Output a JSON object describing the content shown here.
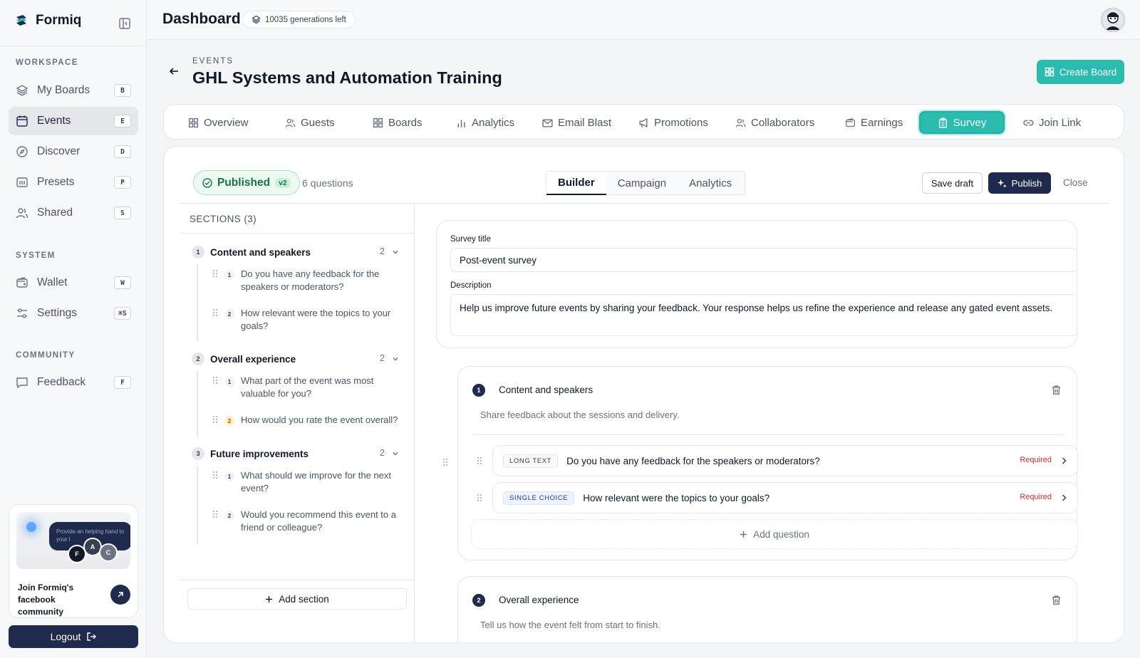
{
  "app": {
    "name": "Formiq"
  },
  "sidebar": {
    "sections": [
      {
        "label": "WORKSPACE",
        "items": [
          {
            "label": "My Boards",
            "key": "B",
            "icon": "layers-icon"
          },
          {
            "label": "Events",
            "key": "E",
            "icon": "calendar-icon",
            "active": true
          },
          {
            "label": "Discover",
            "key": "D",
            "icon": "compass-icon"
          },
          {
            "label": "Presets",
            "key": "P",
            "icon": "presets-icon"
          },
          {
            "label": "Shared",
            "key": "S",
            "icon": "users-icon"
          }
        ]
      },
      {
        "label": "SYSTEM",
        "items": [
          {
            "label": "Wallet",
            "key": "W",
            "icon": "wallet-icon"
          },
          {
            "label": "Settings",
            "key": "⌘S",
            "icon": "sliders-icon"
          }
        ]
      },
      {
        "label": "COMMUNITY",
        "items": [
          {
            "label": "Feedback",
            "key": "F",
            "icon": "message-icon"
          }
        ]
      }
    ],
    "community_card": {
      "bubble_text": "Provide an helping hand to your l",
      "avatars": [
        "F",
        "A",
        "C"
      ],
      "text": "Join Formiq's facebook community"
    },
    "logout_label": "Logout"
  },
  "topbar": {
    "title": "Dashboard",
    "generations": "10035 generations left"
  },
  "header": {
    "eyebrow": "EVENTS",
    "title": "GHL Systems and Automation Training",
    "create_board": "Create Board"
  },
  "tabs": [
    {
      "label": "Overview",
      "icon": "grid-icon"
    },
    {
      "label": "Guests",
      "icon": "users-icon"
    },
    {
      "label": "Boards",
      "icon": "grid-icon"
    },
    {
      "label": "Analytics",
      "icon": "bar-chart-icon"
    },
    {
      "label": "Email Blast",
      "icon": "mail-icon"
    },
    {
      "label": "Promotions",
      "icon": "megaphone-icon"
    },
    {
      "label": "Collaborators",
      "icon": "users-icon"
    },
    {
      "label": "Earnings",
      "icon": "wallet-icon"
    },
    {
      "label": "Survey",
      "icon": "clipboard-icon",
      "active": true
    },
    {
      "label": "Join Link",
      "icon": "link-icon"
    }
  ],
  "survey": {
    "status": "Published",
    "version": "v2",
    "question_count": "6 questions",
    "modes": [
      "Builder",
      "Campaign",
      "Analytics"
    ],
    "active_mode": "Builder",
    "save_draft": "Save draft",
    "publish": "Publish",
    "close": "Close",
    "sections_heading": "SECTIONS (3)",
    "add_section": "Add section",
    "sections": [
      {
        "num": "1",
        "title": "Content and speakers",
        "count": "2",
        "questions": [
          {
            "num": "1",
            "text": "Do you have any feedback for the speakers or moderators?"
          },
          {
            "num": "2",
            "text": "How relevant were the topics to your goals?"
          }
        ]
      },
      {
        "num": "2",
        "title": "Overall experience",
        "count": "2",
        "questions": [
          {
            "num": "1",
            "text": "What part of the event was most valuable for you?"
          },
          {
            "num": "2",
            "text": "How would you rate the event overall?"
          }
        ]
      },
      {
        "num": "3",
        "title": "Future improvements",
        "count": "2",
        "questions": [
          {
            "num": "1",
            "text": "What should we improve for the next event?"
          },
          {
            "num": "2",
            "text": "Would you recommend this event to a friend or colleague?"
          }
        ]
      }
    ],
    "form": {
      "title_label": "Survey title",
      "title_value": "Post-event survey",
      "desc_label": "Description",
      "desc_value": "Help us improve future events by sharing your feedback. Your response helps us refine the experience and release any gated event assets."
    },
    "builder_sections": [
      {
        "num": "1",
        "title": "Content and speakers",
        "desc": "Share feedback about the sessions and delivery.",
        "questions": [
          {
            "type": "LONG TEXT",
            "text": "Do you have any feedback for the speakers or moderators?",
            "required": "Required"
          },
          {
            "type": "SINGLE CHOICE",
            "text": "How relevant were the topics to your goals?",
            "required": "Required"
          }
        ],
        "add_question": "Add question"
      },
      {
        "num": "2",
        "title": "Overall experience",
        "desc": "Tell us how the event felt from start to finish."
      }
    ]
  },
  "colors": {
    "accent": "#2bbcb0",
    "navy": "#1f2a4d",
    "success": "#16734a",
    "danger": "#dc2626"
  }
}
